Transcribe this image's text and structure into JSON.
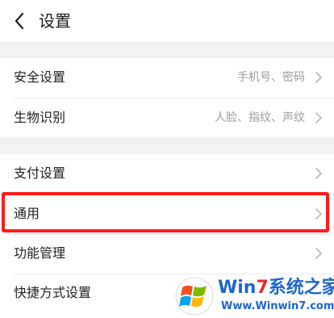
{
  "header": {
    "title": "设置",
    "back_icon": "chevron-left-icon"
  },
  "groups": [
    {
      "items": [
        {
          "label": "安全设置",
          "value": "手机号、密码",
          "icon": "chevron-right-icon"
        },
        {
          "label": "生物识别",
          "value": "人脸、指纹、声纹",
          "icon": "chevron-right-icon"
        }
      ]
    },
    {
      "items": [
        {
          "label": "支付设置",
          "value": "",
          "icon": "chevron-right-icon"
        },
        {
          "label": "通用",
          "value": "",
          "icon": "chevron-right-icon",
          "highlighted": true
        },
        {
          "label": "功能管理",
          "value": "",
          "icon": "chevron-right-icon"
        },
        {
          "label": "快捷方式设置",
          "value": "",
          "icon": "chevron-right-icon"
        }
      ]
    }
  ],
  "annotation": {
    "highlight_color": "#ff1a1a"
  },
  "watermark": {
    "brand_prefix": "Win",
    "brand_number": "7",
    "brand_suffix": "系统之家",
    "url": "Www.Winwin7.com",
    "logo_icon": "windows-logo-icon"
  },
  "colors": {
    "background": "#f2f2f2",
    "surface": "#ffffff",
    "text_primary": "#1f1f1f",
    "text_secondary": "#9b9b9b",
    "divider": "#ececec",
    "watermark_blue": "#1c66c9",
    "watermark_red": "#e22b2b"
  }
}
